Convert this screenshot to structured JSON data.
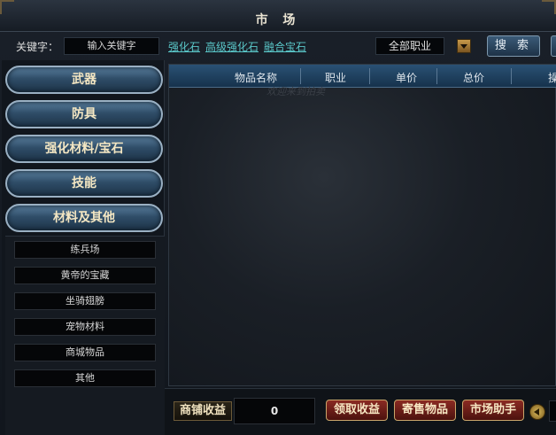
{
  "window": {
    "title": "市 场"
  },
  "search": {
    "keyword_label": "关键字：",
    "keyword_placeholder": "输入关键字",
    "quick_links": [
      "强化石",
      "高级强化石",
      "融合宝石"
    ],
    "job_filter": "全部职业",
    "search_button": "搜 索"
  },
  "sidebar": {
    "categories": [
      "武器",
      "防具",
      "强化材料/宝石",
      "技能",
      "材料及其他"
    ],
    "subcategories": [
      "练兵场",
      "黄帝的宝藏",
      "坐骑翅膀",
      "宠物材料",
      "商城物品",
      "其他"
    ]
  },
  "table": {
    "columns": [
      "物品名称",
      "职业",
      "单价",
      "总价",
      "操"
    ],
    "watermark": "欢迎来到拍卖"
  },
  "bottom": {
    "earnings_label": "商铺收益",
    "earnings_value": "0",
    "buttons": [
      "领取收益",
      "寄售物品",
      "市场助手"
    ]
  }
}
